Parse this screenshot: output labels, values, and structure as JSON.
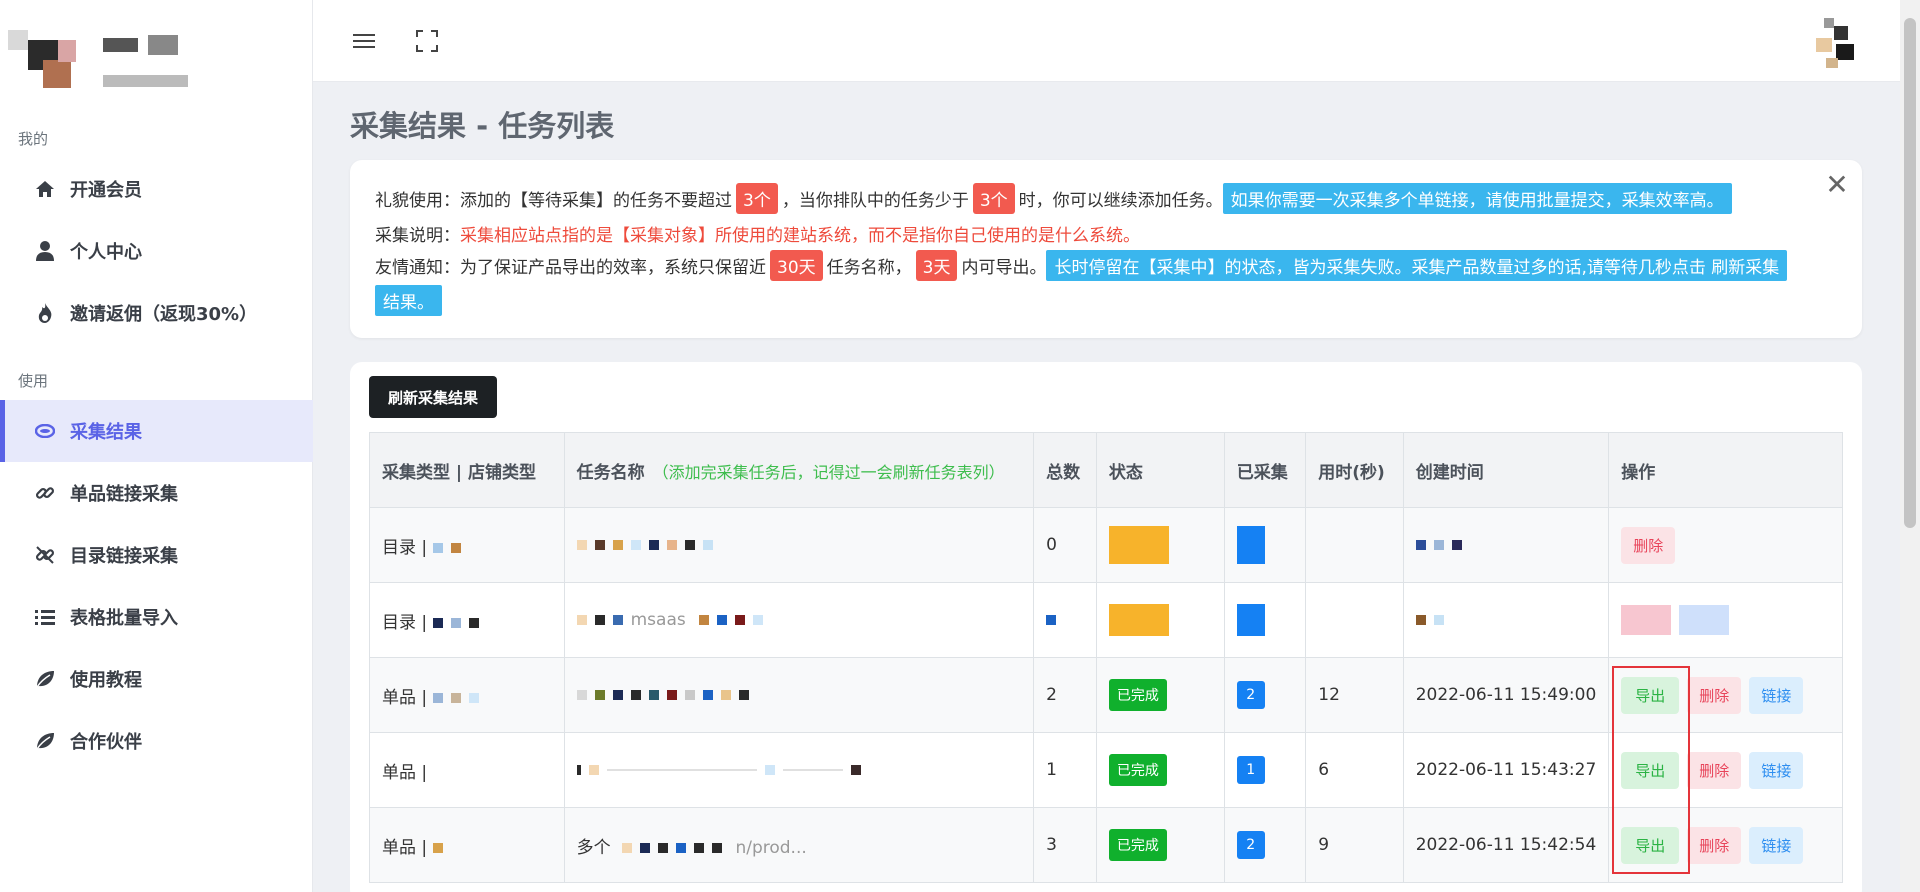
{
  "sidebar": {
    "group_mine": "我的",
    "group_use": "使用",
    "items": [
      {
        "label": "开通会员",
        "icon": "home-icon"
      },
      {
        "label": "个人中心",
        "icon": "user-icon"
      },
      {
        "label": "邀请返佣（返现30%）",
        "icon": "fire-icon"
      },
      {
        "label": "采集结果",
        "icon": "database-icon",
        "active": true
      },
      {
        "label": "单品链接采集",
        "icon": "link-icon"
      },
      {
        "label": "目录链接采集",
        "icon": "unlink-icon"
      },
      {
        "label": "表格批量导入",
        "icon": "list-icon"
      },
      {
        "label": "使用教程",
        "icon": "leaf-icon"
      },
      {
        "label": "合作伙伴",
        "icon": "leaf-icon"
      }
    ]
  },
  "page_title": "采集结果 - 任务列表",
  "notice": {
    "line1": {
      "label": "礼貌使用：",
      "text_a": "添加的【等待采集】的任务不要超过",
      "badge_a": "3个",
      "text_b": "，当你排队中的任务少于",
      "badge_b": "3个",
      "text_c": "时，你可以继续添加任务。",
      "tip": "如果你需要一次采集多个单链接，请使用批量提交，采集效率高。"
    },
    "line2": {
      "label": "采集说明：",
      "text": "采集相应站点指的是【采集对象】所使用的建站系统，而不是指你自己使用的是什么系统。"
    },
    "line3": {
      "label": "友情通知：",
      "text_a": "为了保证产品导出的效率，系统只保留近",
      "badge_a": "30天",
      "text_b": "任务名称，",
      "badge_b": "3天",
      "text_c": "内可导出。",
      "tip_a": "长时停留在【采集中】的状态，皆为采集失败。采集产品数量过多的话,请等待几秒点击 刷新采集",
      "tip_b": "结果。"
    }
  },
  "refresh_button": "刷新采集结果",
  "table": {
    "headers": {
      "type": "采集类型 | 店铺类型",
      "name": "任务名称",
      "name_note": "（添加完采集任务后，记得过一会刷新任务表列）",
      "total": "总数",
      "status": "状态",
      "collected": "已采集",
      "duration": "用时(秒)",
      "created": "创建时间",
      "ops": "操作"
    },
    "rows": [
      {
        "type": "目录 | ",
        "name": "",
        "total": "0",
        "status": "",
        "collected": "",
        "duration": "",
        "created": "",
        "ops": [
          "删除"
        ]
      },
      {
        "type": "目录 | ",
        "name": "msaas",
        "total": "",
        "status": "",
        "collected": "",
        "duration": "",
        "created": "",
        "ops": []
      },
      {
        "type": "单品 | ",
        "name": "",
        "total": "2",
        "status": "已完成",
        "collected": "2",
        "duration": "12",
        "created": "2022-06-11 15:49:00",
        "ops": [
          "导出",
          "删除",
          "链接"
        ]
      },
      {
        "type": "单品 | ",
        "name": "",
        "total": "1",
        "status": "已完成",
        "collected": "1",
        "duration": "6",
        "created": "2022-06-11 15:43:27",
        "ops": [
          "导出",
          "删除",
          "链接"
        ]
      },
      {
        "type": "单品 | ",
        "name": "多个",
        "name_tail": "n/prod...",
        "total": "3",
        "status": "已完成",
        "collected": "2",
        "duration": "9",
        "created": "2022-06-11 15:42:54",
        "ops": [
          "导出",
          "删除",
          "链接"
        ]
      }
    ]
  },
  "colors": {
    "accent": "#5a63e6",
    "badge_red": "#f25a4f",
    "badge_blue": "#3ab6ee",
    "status_green": "#10b02d",
    "count_blue": "#1581f3",
    "highlight_border": "#e4343a"
  }
}
